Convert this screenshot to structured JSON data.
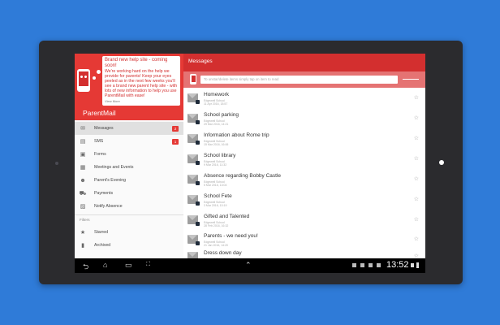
{
  "drawer": {
    "promo_title": "Brand new help site - coming soon!",
    "promo_body": "We're working hard on the help we provide for parents! Keep your eyes peeled as in the next few weeks you'll see a brand new parent help site - with lots of new information to help you use ParentMail with ease!",
    "promo_more": "View More",
    "brand": "ParentMail",
    "items": [
      {
        "label": "Messages",
        "icon": "envelope-icon",
        "badge": "2",
        "active": true
      },
      {
        "label": "SMS",
        "icon": "sms-icon",
        "badge": "1"
      },
      {
        "label": "Forms",
        "icon": "form-icon"
      },
      {
        "label": "Meetings and Events",
        "icon": "calendar-icon"
      },
      {
        "label": "Parent's Evening",
        "icon": "people-icon"
      },
      {
        "label": "Payments",
        "icon": "basket-icon"
      },
      {
        "label": "Notify Absence",
        "icon": "notify-icon"
      }
    ],
    "filters_label": "Filters",
    "filters": [
      {
        "label": "Starred",
        "icon": "star-icon"
      },
      {
        "label": "Archived",
        "icon": "trash-icon"
      }
    ]
  },
  "messages": {
    "title": "Messages",
    "hint": "To unstar/delete items simply tap on item to read",
    "items": [
      {
        "title": "Homework",
        "school": "Edgewell School",
        "date": "11 Apr 2016, 18:57"
      },
      {
        "title": "School parking",
        "school": "Edgewell School",
        "date": "29 Mar 2016, 14:21"
      },
      {
        "title": "Information about Rome trip",
        "school": "Edgewell School",
        "date": "15 Mar 2016, 16:06"
      },
      {
        "title": "School library",
        "school": "Edgewell School",
        "date": "9 Mar 2016, 11:32"
      },
      {
        "title": "Absence regarding Bobby Castle",
        "school": "Edgewell School",
        "date": "5 Mar 2016, 13:04"
      },
      {
        "title": "School Fete",
        "school": "Edgewell School",
        "date": "3 Mar 2016, 10:19"
      },
      {
        "title": "Gifted and Talented",
        "school": "Edgewell School",
        "date": "28 Feb 2016, 16:32"
      },
      {
        "title": "Parents - we need you!",
        "school": "Edgewell School",
        "date": "21 Jan 2016, 14:20"
      },
      {
        "title": "Dress down day",
        "school": "Edgewell School",
        "date": "18 Jan 2016, 15:10"
      }
    ]
  },
  "system": {
    "clock": "13:52"
  },
  "colors": {
    "accent": "#d32f2f",
    "hint": "#e57373",
    "background": "#2f7bd8"
  }
}
